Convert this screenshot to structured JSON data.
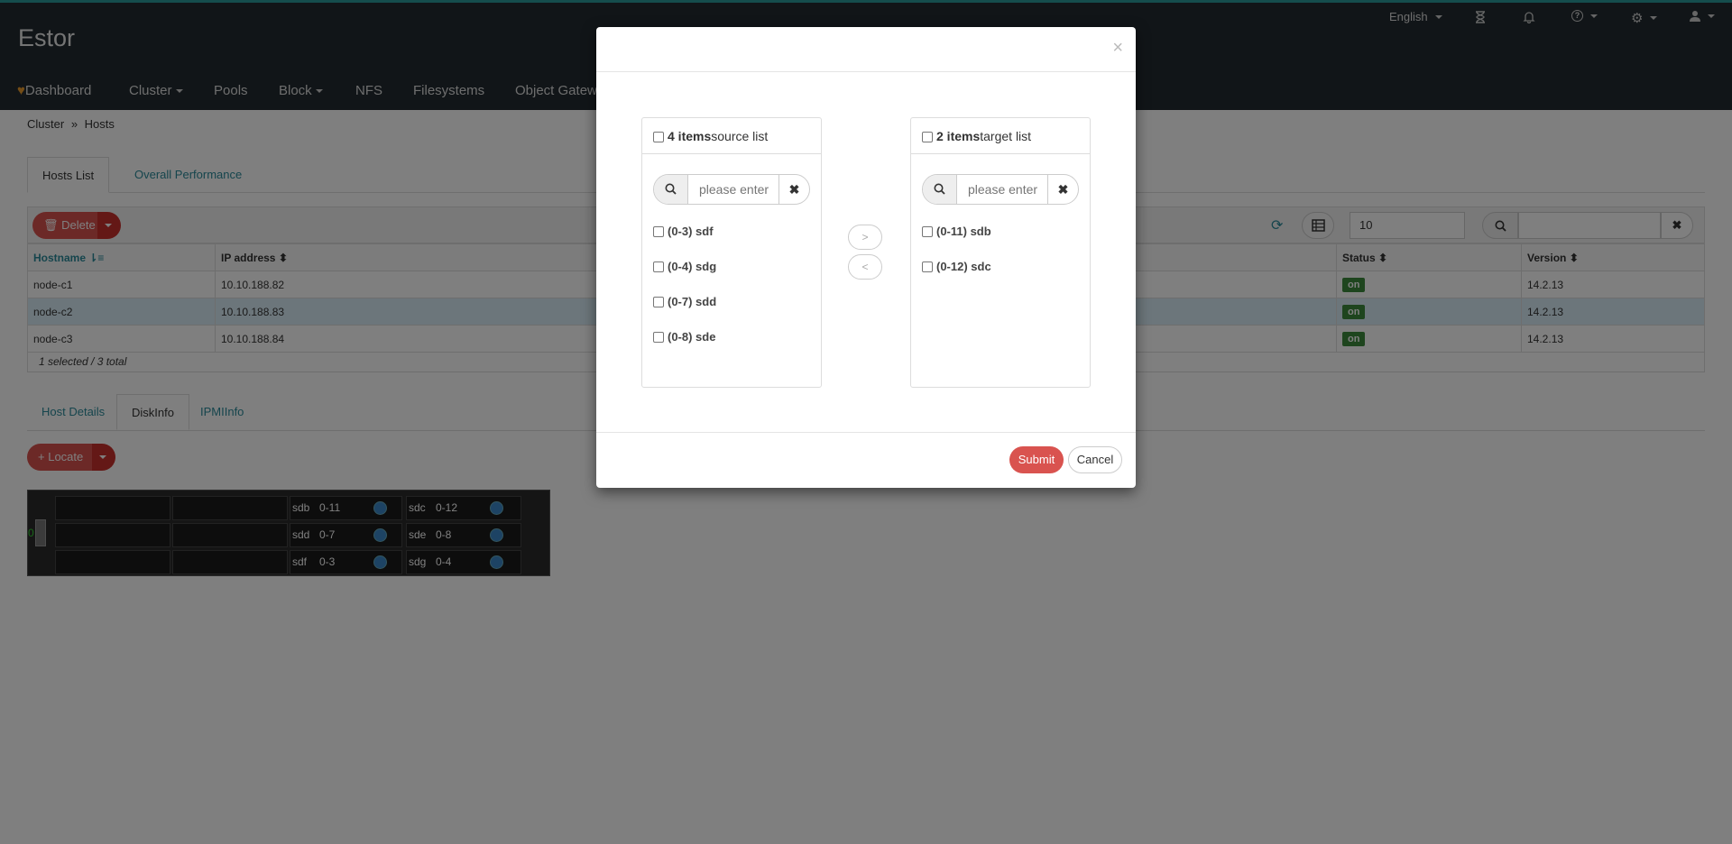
{
  "app": {
    "brand": "Estor"
  },
  "topbar": {
    "language": "English"
  },
  "nav": [
    "Dashboard",
    "Cluster",
    "Pools",
    "Block",
    "NFS",
    "Filesystems",
    "Object Gatew"
  ],
  "breadcrumb": {
    "parent": "Cluster",
    "current": "Hosts"
  },
  "tabs_main": [
    "Hosts List",
    "Overall Performance"
  ],
  "toolbar": {
    "delete_label": "Delete",
    "page_size": "10"
  },
  "hosts_table": {
    "columns": [
      "Hostname",
      "IP address",
      "Status",
      "Version"
    ],
    "rows": [
      {
        "hostname": "node-c1",
        "ip": "10.10.188.82",
        "status": "on",
        "version": "14.2.13"
      },
      {
        "hostname": "node-c2",
        "ip": "10.10.188.83",
        "status": "on",
        "version": "14.2.13"
      },
      {
        "hostname": "node-c3",
        "ip": "10.10.188.84",
        "status": "on",
        "version": "14.2.13"
      }
    ],
    "footer": "1 selected / 3 total"
  },
  "tabs_detail": [
    "Host Details",
    "DiskInfo",
    "IPMIInfo"
  ],
  "locate_label": "Locate",
  "chassis": {
    "side_label": "0",
    "disks": [
      {
        "name": "sdb",
        "id": "0-11"
      },
      {
        "name": "sdc",
        "id": "0-12"
      },
      {
        "name": "sdd",
        "id": "0-7"
      },
      {
        "name": "sde",
        "id": "0-8"
      },
      {
        "name": "sdf",
        "id": "0-3"
      },
      {
        "name": "sdg",
        "id": "0-4"
      }
    ]
  },
  "modal": {
    "close": "×",
    "source": {
      "count": "4 items",
      "title": "source list",
      "placeholder": "please enter",
      "items": [
        "(0-3) sdf",
        "(0-4) sdg",
        "(0-7) sdd",
        "(0-8) sde"
      ]
    },
    "target": {
      "count": "2 items",
      "title": "target list",
      "placeholder": "please enter",
      "items": [
        "(0-11) sdb",
        "(0-12) sdc"
      ]
    },
    "move_right": ">",
    "move_left": "<",
    "submit_label": "Submit",
    "cancel_label": "Cancel"
  }
}
